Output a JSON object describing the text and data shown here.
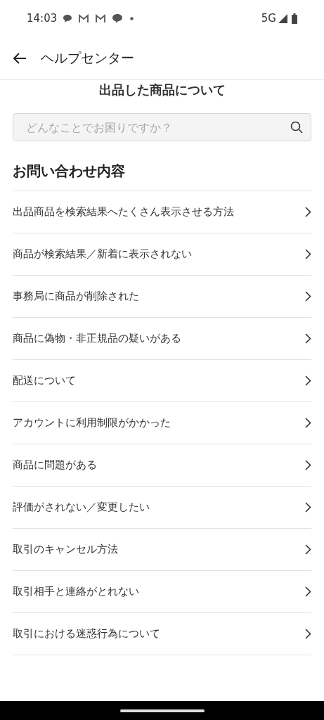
{
  "status_bar": {
    "time": "14:03",
    "network": "5G"
  },
  "header": {
    "title": "ヘルプセンター"
  },
  "partial_heading": "出品した商品について",
  "search": {
    "placeholder": "どんなことでお困りですか？"
  },
  "section": {
    "title": "お問い合わせ内容",
    "items": [
      {
        "label": "出品商品を検索結果へたくさん表示させる方法"
      },
      {
        "label": "商品が検索結果／新着に表示されない"
      },
      {
        "label": "事務局に商品が削除された"
      },
      {
        "label": "商品に偽物・非正規品の疑いがある"
      },
      {
        "label": "配送について"
      },
      {
        "label": "アカウントに利用制限がかかった"
      },
      {
        "label": "商品に問題がある"
      },
      {
        "label": "評価がされない／変更したい"
      },
      {
        "label": "取引のキャンセル方法"
      },
      {
        "label": "取引相手と連絡がとれない"
      },
      {
        "label": "取引における迷惑行為について"
      }
    ]
  }
}
